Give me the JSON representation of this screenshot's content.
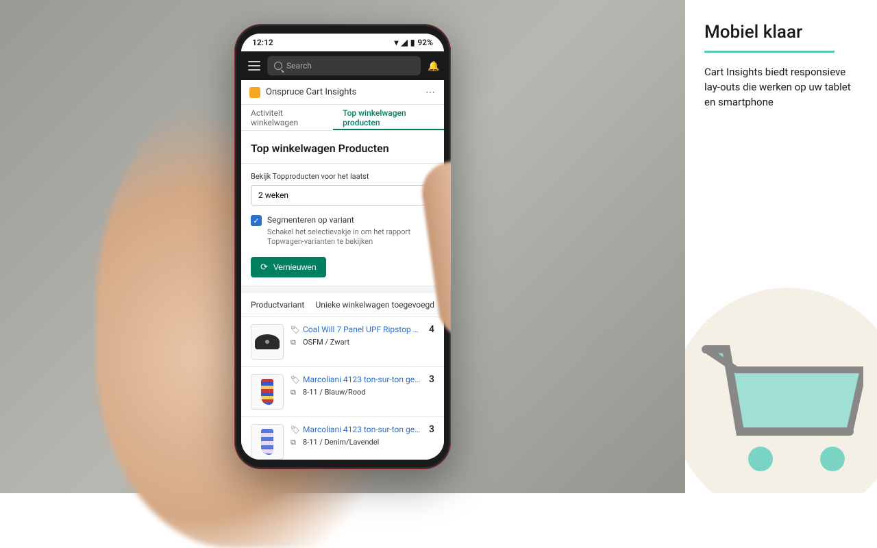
{
  "status": {
    "time": "12:12",
    "battery": "92%"
  },
  "search": {
    "placeholder": "Search"
  },
  "app": {
    "title": "Onspruce Cart Insights"
  },
  "tabs": {
    "activity": "Activiteit winkelwagen",
    "top": "Top winkelwagen producten"
  },
  "section": {
    "title": "Top winkelwagen Producten"
  },
  "filter": {
    "label": "Bekijk Topproducten voor het laatst",
    "value": "2 weken"
  },
  "segment": {
    "label": "Segmenteren op variant",
    "sub": "Schakel het selectievakje in om het rapport Topwagen-varianten te bekijken"
  },
  "refresh": {
    "label": "Vernieuwen"
  },
  "table": {
    "col1": "Productvariant",
    "col2": "Unieke winkelwagen toegevoegd"
  },
  "products": [
    {
      "name": "Coal Will 7 Panel UPF Ripstop Snapp…",
      "variant": "OSFM / Zwart",
      "count": "4"
    },
    {
      "name": "Marcoliani 4123 ton-sur-ton gestree…",
      "variant": "8-11 / Blauw/Rood",
      "count": "3"
    },
    {
      "name": "Marcoliani 4123 ton-sur-ton gestree…",
      "variant": "8-11 / Denim/Lavendel",
      "count": "3"
    }
  ],
  "promo": {
    "title": "Mobiel klaar",
    "body": "Cart Insights biedt responsieve lay-outs die werken op uw tablet en smartphone"
  }
}
